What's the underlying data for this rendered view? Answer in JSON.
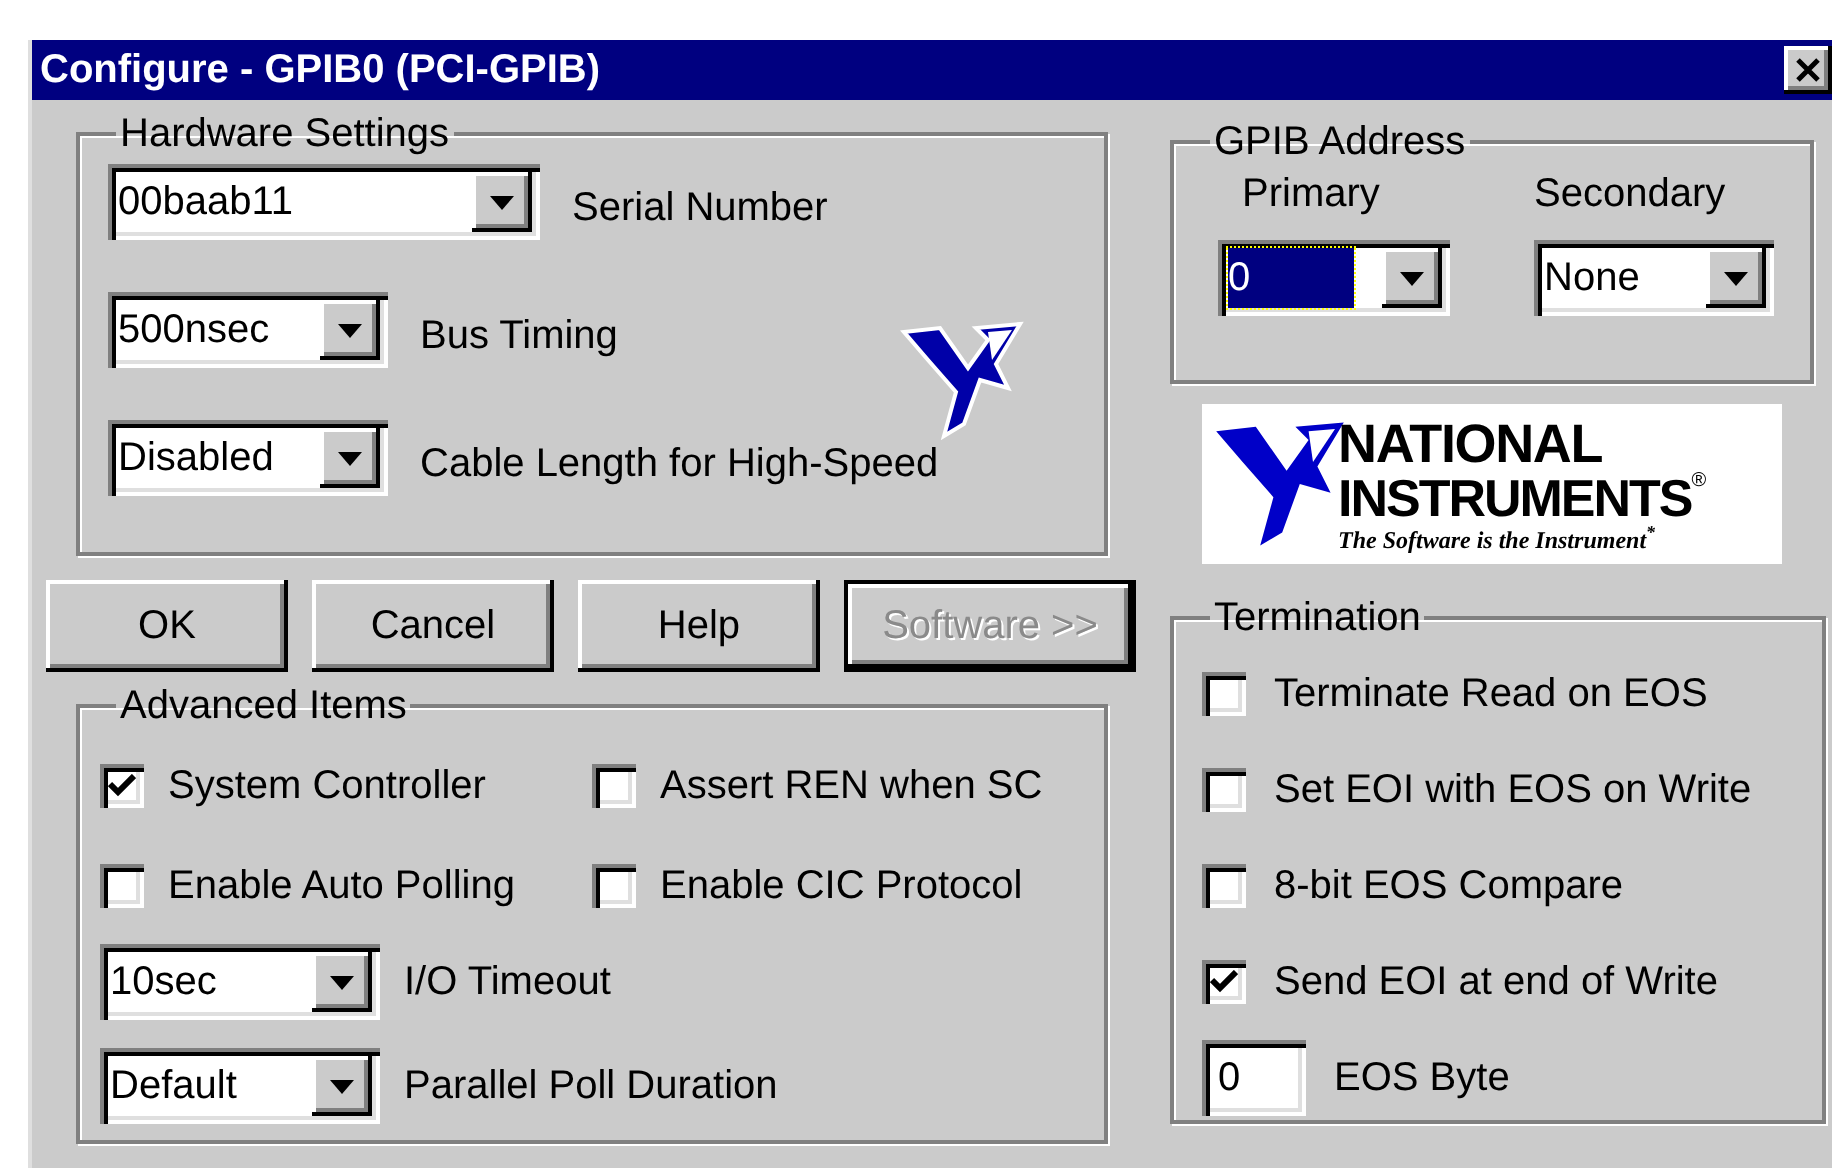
{
  "window": {
    "title": "Configure - GPIB0 (PCI-GPIB)"
  },
  "hardware_settings": {
    "title": "Hardware Settings",
    "rows": [
      {
        "value": "00baab11",
        "label": "Serial Number"
      },
      {
        "value": "500nsec",
        "label": "Bus Timing"
      },
      {
        "value": "Disabled",
        "label": "Cable Length for High-Speed"
      }
    ]
  },
  "gpib_address": {
    "title": "GPIB Address",
    "fields": [
      {
        "label": "Primary",
        "value": "0",
        "focused": true
      },
      {
        "label": "Secondary",
        "value": "None",
        "focused": false
      }
    ]
  },
  "logo": {
    "line_1": "NATIONAL",
    "line_2": "INSTRUMENTS",
    "mark": "®",
    "tagline": "The Software is the Instrument$^{*}$"
  },
  "buttons": [
    {
      "label": "OK",
      "disabled": false,
      "default": false
    },
    {
      "label": "Cancel",
      "disabled": false,
      "default": false
    },
    {
      "label": "Help",
      "disabled": false,
      "default": false
    },
    {
      "label": "Software >>",
      "disabled": true,
      "default": true
    }
  ],
  "advanced_items": {
    "title": "Advanced Items",
    "checkboxes": [
      {
        "label": "System Controller",
        "checked": true
      },
      {
        "label": "Assert REN when SC",
        "checked": false
      },
      {
        "label": "Enable Auto Polling",
        "checked": false
      },
      {
        "label": "Enable CIC Protocol",
        "checked": false
      }
    ],
    "rows": [
      {
        "value": "10sec",
        "label": "I/O Timeout"
      },
      {
        "value": "Default",
        "label": "Parallel Poll Duration"
      }
    ]
  },
  "termination": {
    "title": "Termination",
    "checkboxes": [
      {
        "label": "Terminate Read on EOS",
        "checked": false
      },
      {
        "label": "Set EOI with EOS on Write",
        "checked": false
      },
      {
        "label": "8-bit EOS Compare",
        "checked": false
      },
      {
        "label": "Send EOI at end of Write",
        "checked": true
      }
    ],
    "eos_byte": {
      "value": "0",
      "label": "EOS Byte"
    }
  }
}
